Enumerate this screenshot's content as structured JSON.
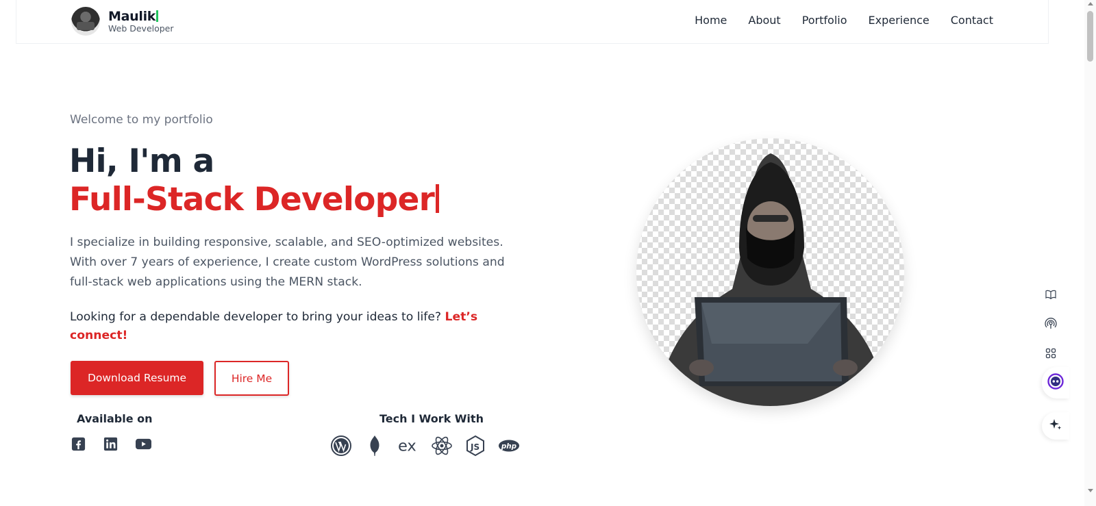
{
  "header": {
    "brand_name": "Maulik",
    "brand_subtitle": "Web Developer",
    "nav": [
      {
        "label": "Home"
      },
      {
        "label": "About"
      },
      {
        "label": "Portfolio"
      },
      {
        "label": "Experience"
      },
      {
        "label": "Contact"
      }
    ]
  },
  "hero": {
    "welcome": "Welcome to my portfolio",
    "greeting": "Hi, I'm a",
    "role": "Full-Stack Developer",
    "bio": "I specialize in building responsive, scalable, and SEO-optimized websites. With over 7 years of experience, I create custom WordPress solutions and full-stack web applications using the MERN stack.",
    "cta_text": "Looking for a dependable developer to bring your ideas to life? ",
    "cta_link": "Let’s connect!",
    "download_button": "Download Resume",
    "hire_button": "Hire Me",
    "available_title": "Available on",
    "social_icons": [
      "facebook-icon",
      "linkedin-icon",
      "youtube-icon"
    ],
    "tech_title": "Tech I Work With",
    "tech_icons": [
      "wordpress-icon",
      "mongodb-icon",
      "express-icon",
      "react-icon",
      "nodejs-icon",
      "php-icon"
    ],
    "express_text": "ex",
    "php_text": "php"
  },
  "colors": {
    "accent": "#dc2626",
    "heading": "#1f2937",
    "muted": "#6b7280",
    "status_green": "#22c55e"
  }
}
